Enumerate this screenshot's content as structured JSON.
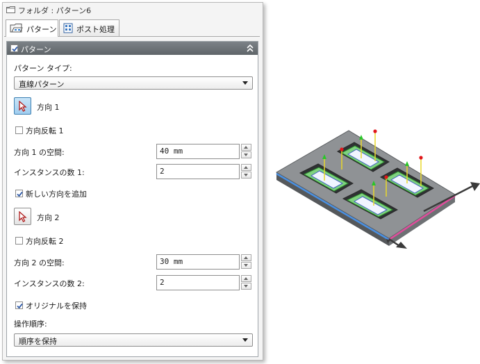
{
  "window": {
    "title": "フォルダ : パターン6"
  },
  "tabs": [
    {
      "label": "パターン",
      "icon": "pattern-icon",
      "active": true
    },
    {
      "label": "ポスト処理",
      "icon": "post-process-icon",
      "active": false
    }
  ],
  "group": {
    "title": "パターン",
    "checked": true,
    "collapse_icon": "double-chevron-up-icon"
  },
  "form": {
    "pattern_type_label": "パターン タイプ:",
    "pattern_type_value": "直線パターン",
    "direction1": {
      "label": "方向 1",
      "icon": "cursor-pick-icon",
      "pressed": true
    },
    "reverse1": {
      "label": "方向反転 1",
      "checked": false
    },
    "spacing1": {
      "label": "方向 1 の空間:",
      "value": "40 mm"
    },
    "count1": {
      "label": "インスタンスの数 1:",
      "value": "2"
    },
    "add_direction": {
      "label": "新しい方向を追加",
      "checked": true
    },
    "direction2": {
      "label": "方向 2",
      "icon": "cursor-pick-icon",
      "pressed": false
    },
    "reverse2": {
      "label": "方向反転 2",
      "checked": false
    },
    "spacing2": {
      "label": "方向 2 の空間:",
      "value": "30 mm"
    },
    "count2": {
      "label": "インスタンスの数 2:",
      "value": "2"
    },
    "keep_original": {
      "label": "オリジナルを保持",
      "checked": true
    },
    "operation_order_label": "操作順序:",
    "operation_order_value": "順序を保持"
  },
  "colors": {
    "header_bg": "#676d72",
    "pick_active": "#a9d4f2",
    "direction1_axis": "#4a90e2",
    "direction2_axis": "#e04c9c",
    "pocket_green": "#3ea53e",
    "marker_red": "#e0161b",
    "marker_yellow": "#e8d82a"
  }
}
